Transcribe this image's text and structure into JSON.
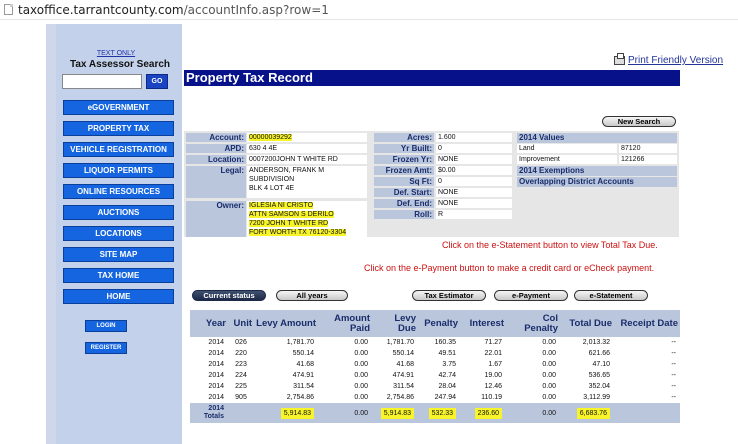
{
  "browser": {
    "url_host": "taxoffice.tarrantcounty.com",
    "url_path": "/accountInfo.asp?row=1"
  },
  "sidebar": {
    "text_only": "TEXT ONLY",
    "title": "Tax Assessor Search",
    "go": "GO",
    "nav": [
      "eGOVERNMENT",
      "PROPERTY TAX",
      "VEHICLE REGISTRATION",
      "LIQUOR PERMITS",
      "ONLINE RESOURCES",
      "AUCTIONS",
      "LOCATIONS",
      "SITE MAP",
      "TAX HOME",
      "HOME"
    ],
    "login": "LOGIN",
    "register": "REGISTER"
  },
  "header": {
    "print": "Print Friendly Version",
    "title": "Property Tax Record",
    "new_search": "New Search"
  },
  "account": {
    "labels": {
      "account": "Account:",
      "apd": "APD:",
      "location": "Location:",
      "legal": "Legal:",
      "owner": "Owner:"
    },
    "account": "00000039292",
    "apd": "630 4 4E",
    "location": "0007200JOHN T WHITE RD",
    "legal": [
      "ANDERSON, FRANK M",
      "SUBDIVISION",
      "BLK 4 LOT 4E"
    ],
    "owner": [
      "IGLESIA NI CRISTO",
      "ATTN SAMSON S DERILO",
      "7200 JOHN T WHITE RD",
      "FORT WORTH TX 76120-3304"
    ]
  },
  "details": {
    "labels": {
      "acres": "Acres:",
      "yr_built": "Yr Built:",
      "frozen_yr": "Frozen Yr:",
      "frozen_amt": "Frozen Amt:",
      "sq_ft": "Sq Ft:",
      "def_start": "Def. Start:",
      "def_end": "Def. End:",
      "roll": "Roll:"
    },
    "acres": "1.600",
    "yr_built": "0",
    "frozen_yr": "NONE",
    "frozen_amt": "$0.00",
    "sq_ft": "0",
    "def_start": "NONE",
    "def_end": "NONE",
    "roll": "R"
  },
  "values": {
    "header": "2014 Values",
    "land_label": "Land",
    "land": "87120",
    "improvement_label": "Improvement",
    "improvement": "121266",
    "exemptions": "2014 Exemptions",
    "overlapping": "Overlapping District Accounts"
  },
  "messages": {
    "estatement": "Click on the e-Statement button to view Total Tax Due.",
    "epayment": "Click on the e-Payment button to make a credit card or eCheck payment."
  },
  "buttons": {
    "current_status": "Current status",
    "all_years": "All years",
    "tax_estimator": "Tax Estimator",
    "e_payment": "e-Payment",
    "e_statement": "e-Statement"
  },
  "table": {
    "headers": [
      "Year",
      "Unit",
      "Levy Amount",
      "Amount Paid",
      "Levy Due",
      "Penalty",
      "Interest",
      "Col Penalty",
      "Total Due",
      "Receipt Date"
    ],
    "rows": [
      [
        "2014",
        "026",
        "1,781.70",
        "0.00",
        "1,781.70",
        "160.35",
        "71.27",
        "0.00",
        "2,013.32",
        "--"
      ],
      [
        "2014",
        "220",
        "550.14",
        "0.00",
        "550.14",
        "49.51",
        "22.01",
        "0.00",
        "621.66",
        "--"
      ],
      [
        "2014",
        "223",
        "41.68",
        "0.00",
        "41.68",
        "3.75",
        "1.67",
        "0.00",
        "47.10",
        "--"
      ],
      [
        "2014",
        "224",
        "474.91",
        "0.00",
        "474.91",
        "42.74",
        "19.00",
        "0.00",
        "536.65",
        "--"
      ],
      [
        "2014",
        "225",
        "311.54",
        "0.00",
        "311.54",
        "28.04",
        "12.46",
        "0.00",
        "352.04",
        "--"
      ],
      [
        "2014",
        "905",
        "2,754.86",
        "0.00",
        "2,754.86",
        "247.94",
        "110.19",
        "0.00",
        "3,112.99",
        "--"
      ]
    ],
    "totals_label_year": "2014",
    "totals_label": "Totals",
    "totals": {
      "levy_amount": "5,914.83",
      "amount_paid": "0.00",
      "levy_due": "5,914.83",
      "penalty": "532.33",
      "interest": "236.60",
      "col_penalty": "0.00",
      "total_due": "6,683.76"
    }
  }
}
